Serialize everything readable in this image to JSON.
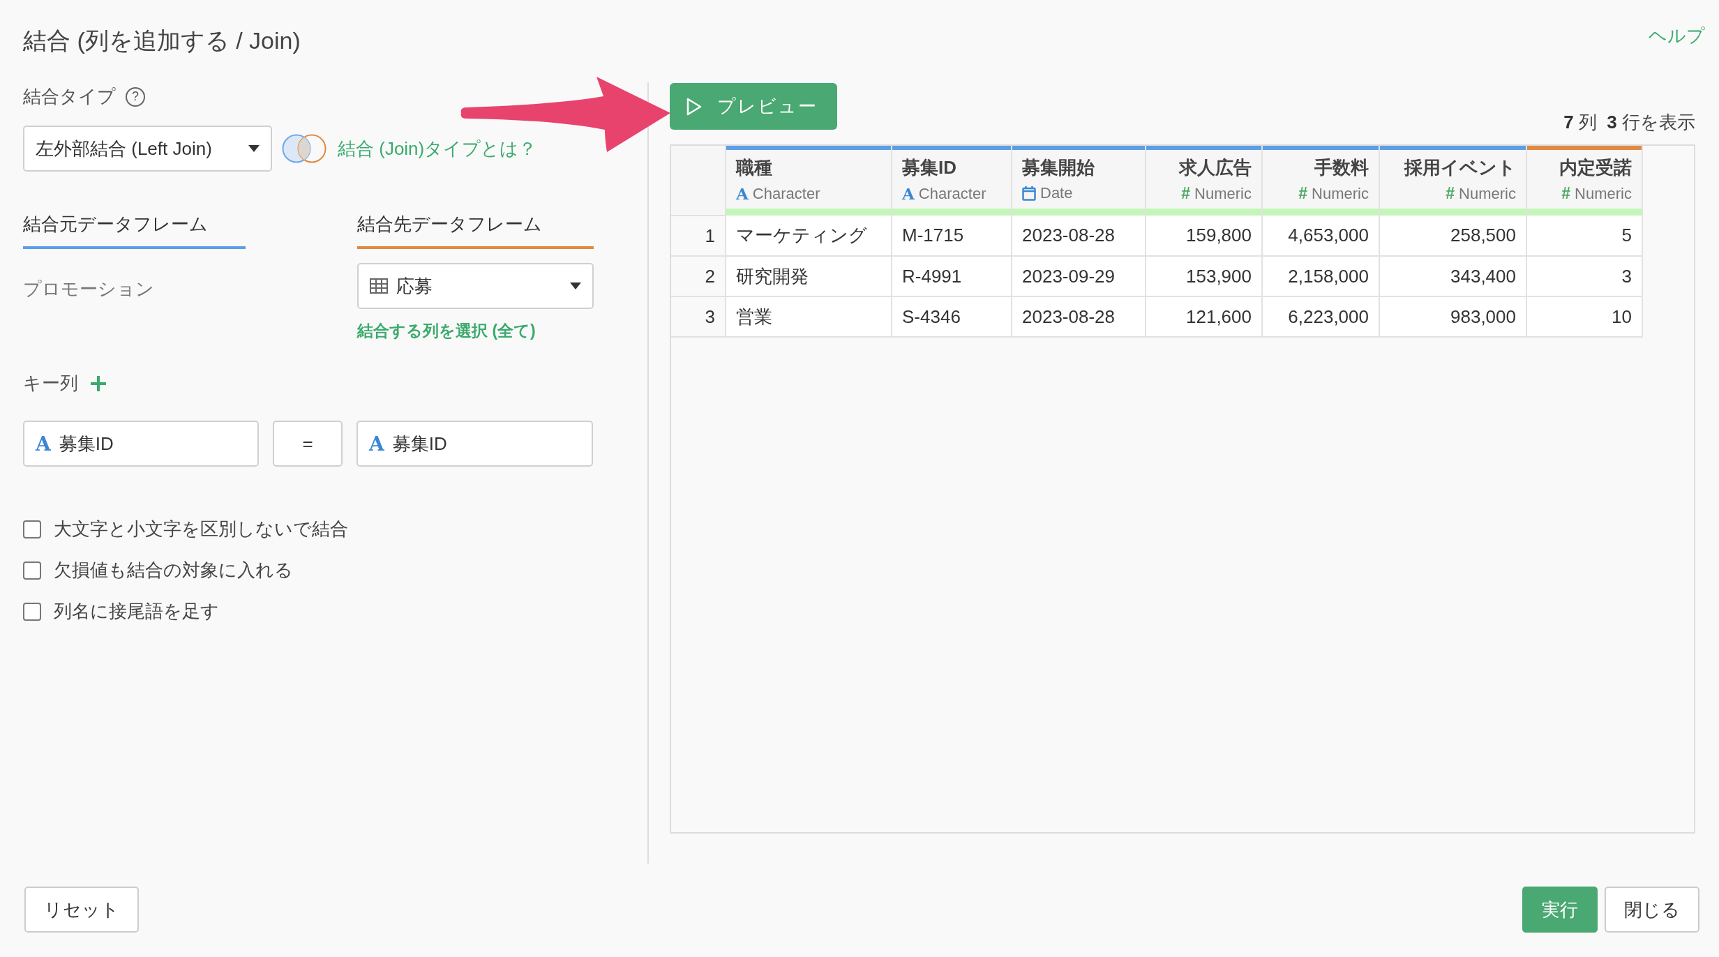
{
  "title": "結合 (列を追加する / Join)",
  "help_link": "ヘルプ",
  "join_type": {
    "label": "結合タイプ",
    "help_icon": "?",
    "dropdown": "左外部結合 (Left Join)",
    "link": "結合 (Join)タイプとは？"
  },
  "source": {
    "heading": "結合元データフレーム",
    "color": "#5d9ee8",
    "name": "プロモーション"
  },
  "target": {
    "heading": "結合先データフレーム",
    "color": "#e0893f",
    "dropdown": "応募",
    "select_columns_link": "結合する列を選択 (全て)"
  },
  "key_columns": {
    "label": "キー列",
    "pairs": [
      {
        "left": {
          "type_icon": "A",
          "name": "募集ID"
        },
        "operator": "=",
        "right": {
          "type_icon": "A",
          "name": "募集ID"
        }
      }
    ]
  },
  "options": [
    {
      "label": "大文字と小文字を区別しないで結合",
      "checked": false
    },
    {
      "label": "欠損値も結合の対象に入れる",
      "checked": false
    },
    {
      "label": "列名に接尾語を足す",
      "checked": false
    }
  ],
  "preview": {
    "button": "プレビュー",
    "summary": "**7** 列  **3** 行を表示"
  },
  "table": {
    "columns": [
      {
        "name": "職種",
        "kind": "character",
        "type_icon": "A",
        "type": "Character",
        "color": "#5d9ee8"
      },
      {
        "name": "募集ID",
        "kind": "character",
        "type_icon": "A",
        "type": "Character",
        "color": "#5d9ee8"
      },
      {
        "name": "募集開始",
        "kind": "date",
        "type": "Date",
        "color": "#5d9ee8"
      },
      {
        "name": "求人広告",
        "kind": "numeric",
        "type_icon": "#",
        "type": "Numeric",
        "color": "#5d9ee8"
      },
      {
        "name": "手数料",
        "kind": "numeric",
        "type_icon": "#",
        "type": "Numeric",
        "color": "#5d9ee8"
      },
      {
        "name": "採用イベント",
        "kind": "numeric",
        "type_icon": "#",
        "type": "Numeric",
        "color": "#5d9ee8"
      },
      {
        "name": "内定受諾",
        "kind": "numeric",
        "type_icon": "#",
        "type": "Numeric",
        "color": "#e0893f"
      }
    ],
    "rows": [
      {
        "number": "1",
        "cells": [
          "マーケティング",
          "M-1715",
          "2023-08-28",
          "159,800",
          "4,653,000",
          "258,500",
          "5"
        ]
      },
      {
        "number": "2",
        "cells": [
          "研究開発",
          "R-4991",
          "2023-09-29",
          "153,900",
          "2,158,000",
          "343,400",
          "3"
        ]
      },
      {
        "number": "3",
        "cells": [
          "営業",
          "S-4346",
          "2023-08-28",
          "121,600",
          "6,223,000",
          "983,000",
          "10"
        ]
      }
    ]
  },
  "buttons": {
    "reset": "リセット",
    "run": "実行",
    "close": "閉じる"
  }
}
